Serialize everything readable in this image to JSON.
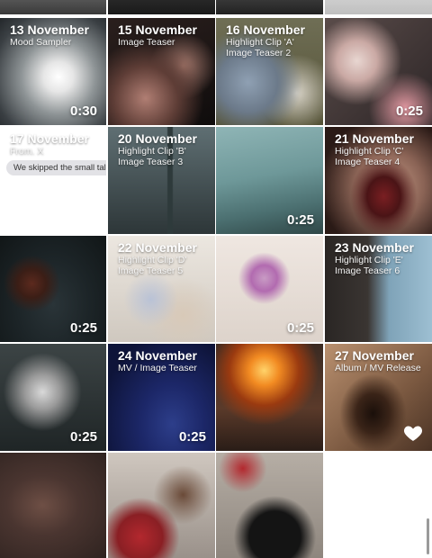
{
  "grid": {
    "tiles": [
      {
        "date": "",
        "line1": "",
        "line2": "",
        "duration": "",
        "icon": "",
        "bubble": "",
        "art": "linear-gradient(#6b6b6b,#3a3a3a)"
      },
      {
        "date": "",
        "line1": "",
        "line2": "",
        "duration": "",
        "icon": "",
        "bubble": "",
        "art": "linear-gradient(#333,#1a1a1a)"
      },
      {
        "date": "",
        "line1": "",
        "line2": "",
        "duration": "",
        "icon": "",
        "bubble": "",
        "art": "linear-gradient(#4a4a4a,#222)"
      },
      {
        "date": "",
        "line1": "",
        "line2": "",
        "duration": "",
        "icon": "",
        "bubble": "",
        "art": "linear-gradient(#d9d9d9,#bfbfbf)"
      },
      {
        "date": "13 November",
        "line1": "Mood Sampler",
        "line2": "",
        "duration": "0:30",
        "icon": "",
        "bubble": "",
        "art": "radial-gradient(ellipse at 55% 55%,#ffffff 0%,#e6e6e6 18%,#8e9496 45%,#3a3f43 80%,#23272a 100%)"
      },
      {
        "date": "15 November",
        "line1": "Image Teaser",
        "line2": "",
        "duration": "",
        "icon": "",
        "bubble": "",
        "art": "radial-gradient(circle at 35% 75%,#b07e73 0%,#5e3d36 30%,rgba(0,0,0,0) 55%),radial-gradient(circle at 70% 45%,#a77a6e 0%,rgba(0,0,0,0) 35%),linear-gradient(160deg,#2a1f1d,#0f0c0c)"
      },
      {
        "date": "16 November",
        "line1": "Highlight Clip 'A'",
        "line2": "Image Teaser 2",
        "duration": "",
        "icon": "",
        "bubble": "",
        "art": "radial-gradient(circle at 30% 60%,#8fa0b3 0%,#6c7a8a 30%,rgba(0,0,0,0) 55%),radial-gradient(circle at 75% 70%,#d9d4c8 0%,rgba(0,0,0,0) 35%),linear-gradient(#6f6e55,#545236)"
      },
      {
        "date": "",
        "line1": "",
        "line2": "",
        "duration": "0:25",
        "icon": "",
        "bubble": "",
        "art": "radial-gradient(circle at 30% 40%,#e8d6d1 0%,#caa9a4 20%,rgba(0,0,0,0) 45%),radial-gradient(circle at 75% 85%,#e49aa3 0%,rgba(0,0,0,0) 30%),linear-gradient(135deg,#5a4c4a,#2c2526)"
      },
      {
        "date": "17 November",
        "line1": "From. X",
        "line2": "",
        "duration": "",
        "icon": "",
        "bubble": "We skipped the small talk",
        "art": "linear-gradient(#ffffff,#ffffff)"
      },
      {
        "date": "20 November",
        "line1": "Highlight Clip 'B'",
        "line2": "Image Teaser 3",
        "duration": "",
        "icon": "",
        "bubble": "",
        "art": "linear-gradient(90deg,rgba(0,0,0,0) 55%,#2e3a3b 56%,#2e3a3b 60%,rgba(0,0,0,0) 61%),linear-gradient(#5f6f73,#2d3638)"
      },
      {
        "date": "",
        "line1": "",
        "line2": "",
        "duration": "0:25",
        "icon": "",
        "bubble": "",
        "art": "linear-gradient(170deg,#8fb5b6 0%,#6e9899 45%,#4b6f70 75%,#2f4747 100%)"
      },
      {
        "date": "21 November",
        "line1": "Highlight Clip 'C'",
        "line2": "Image Teaser 4",
        "duration": "",
        "icon": "",
        "bubble": "",
        "art": "radial-gradient(ellipse at 55% 65%,#7a1f22 0%,#4a1416 20%,rgba(0,0,0,0) 40%),radial-gradient(circle at 60% 55%,#c89c88 0%,#8a6355 40%,#2a1a16 80%)"
      },
      {
        "date": "",
        "line1": "",
        "line2": "",
        "duration": "0:25",
        "icon": "",
        "bubble": "",
        "art": "radial-gradient(circle at 30% 45%,#5c2a1e 0%,#3b1e16 15%,rgba(0,0,0,0) 30%),radial-gradient(ellipse at 50% 65%,#2a3438 0%,#1c2427 50%,#111617 100%)"
      },
      {
        "date": "22 November",
        "line1": "Highlight Clip 'D'",
        "line2": "Image Teaser 5",
        "duration": "",
        "icon": "",
        "bubble": "",
        "art": "radial-gradient(circle at 40% 60%,#b9c2d6 0%,rgba(0,0,0,0) 30%),radial-gradient(circle at 70% 75%,#d8c9b8 0%,rgba(0,0,0,0) 35%),linear-gradient(#ece7e0,#cfc8bf)"
      },
      {
        "date": "",
        "line1": "",
        "line2": "",
        "duration": "0:25",
        "icon": "",
        "bubble": "",
        "art": "radial-gradient(circle at 45% 40%,#c89bc4 0%,#b26bb0 15%,rgba(0,0,0,0) 30%),linear-gradient(#efe7e1,#ddd3cb)"
      },
      {
        "date": "23 November",
        "line1": "Highlight Clip 'E'",
        "line2": "Image Teaser 6",
        "duration": "",
        "icon": "",
        "bubble": "",
        "art": "linear-gradient(90deg,#2a2624 0%,#3a3532 40%,#7fa3b8 60%,#9dbfd2 100%)"
      },
      {
        "date": "",
        "line1": "",
        "line2": "",
        "duration": "0:25",
        "icon": "",
        "bubble": "",
        "art": "radial-gradient(circle at 40% 45%,#d9d9d9 0%,#9a9a9a 20%,rgba(0,0,0,0) 45%),linear-gradient(#3c4445,#1f2526)"
      },
      {
        "date": "24 November",
        "line1": "MV / Image Teaser",
        "line2": "",
        "duration": "0:25",
        "icon": "",
        "bubble": "",
        "art": "radial-gradient(ellipse at 60% 75%,#2d3e8a 0%,#1c2768 35%,#0e1439 80%)"
      },
      {
        "date": "",
        "line1": "",
        "line2": "",
        "duration": "",
        "icon": "",
        "bubble": "",
        "art": "radial-gradient(circle at 45% 25%,#ffd36a 0%,#f28b22 15%,#9a3a10 35%,rgba(0,0,0,0) 55%),linear-gradient(#3a2a22,#5a3a2a 60%,#2a1d17)"
      },
      {
        "date": "27 November",
        "line1": "Album / MV Release",
        "line2": "",
        "duration": "",
        "icon": "heart-icon",
        "bubble": "",
        "art": "radial-gradient(ellipse at 45% 65%,#1a0f0a 0%,#3a2418 20%,rgba(0,0,0,0) 40%),linear-gradient(135deg,#b9906f,#7a5840 60%,#4a3325)"
      },
      {
        "date": "",
        "line1": "",
        "line2": "",
        "duration": "",
        "icon": "",
        "bubble": "",
        "art": "radial-gradient(ellipse at 40% 50%,#6e4f45 0%,#4a3530 40%,#2f2320 100%)"
      },
      {
        "date": "",
        "line1": "",
        "line2": "",
        "duration": "",
        "icon": "",
        "bubble": "",
        "art": "radial-gradient(circle at 30% 80%,#b3282e 0%,#8a1f24 20%,rgba(0,0,0,0) 35%),radial-gradient(circle at 70% 40%,#6a4a38 0%,rgba(0,0,0,0) 30%),linear-gradient(#cfc7bf,#9a918a)"
      },
      {
        "date": "",
        "line1": "",
        "line2": "",
        "duration": "",
        "icon": "",
        "bubble": "",
        "art": "radial-gradient(circle at 25% 15%,#b3282e 0%,rgba(0,0,0,0) 20%),radial-gradient(circle at 55% 80%,#141414 0%,#141414 25%,rgba(0,0,0,0) 40%),linear-gradient(#b6aea5,#8e867e)"
      },
      {
        "date": "",
        "line1": "",
        "line2": "",
        "duration": "",
        "icon": "",
        "bubble": "",
        "art": "linear-gradient(#ffffff,#ffffff)"
      }
    ]
  },
  "colors": {
    "background": "#ffffff",
    "overlay_text": "#ffffff",
    "bubble_bg": "#e2e2e6"
  }
}
